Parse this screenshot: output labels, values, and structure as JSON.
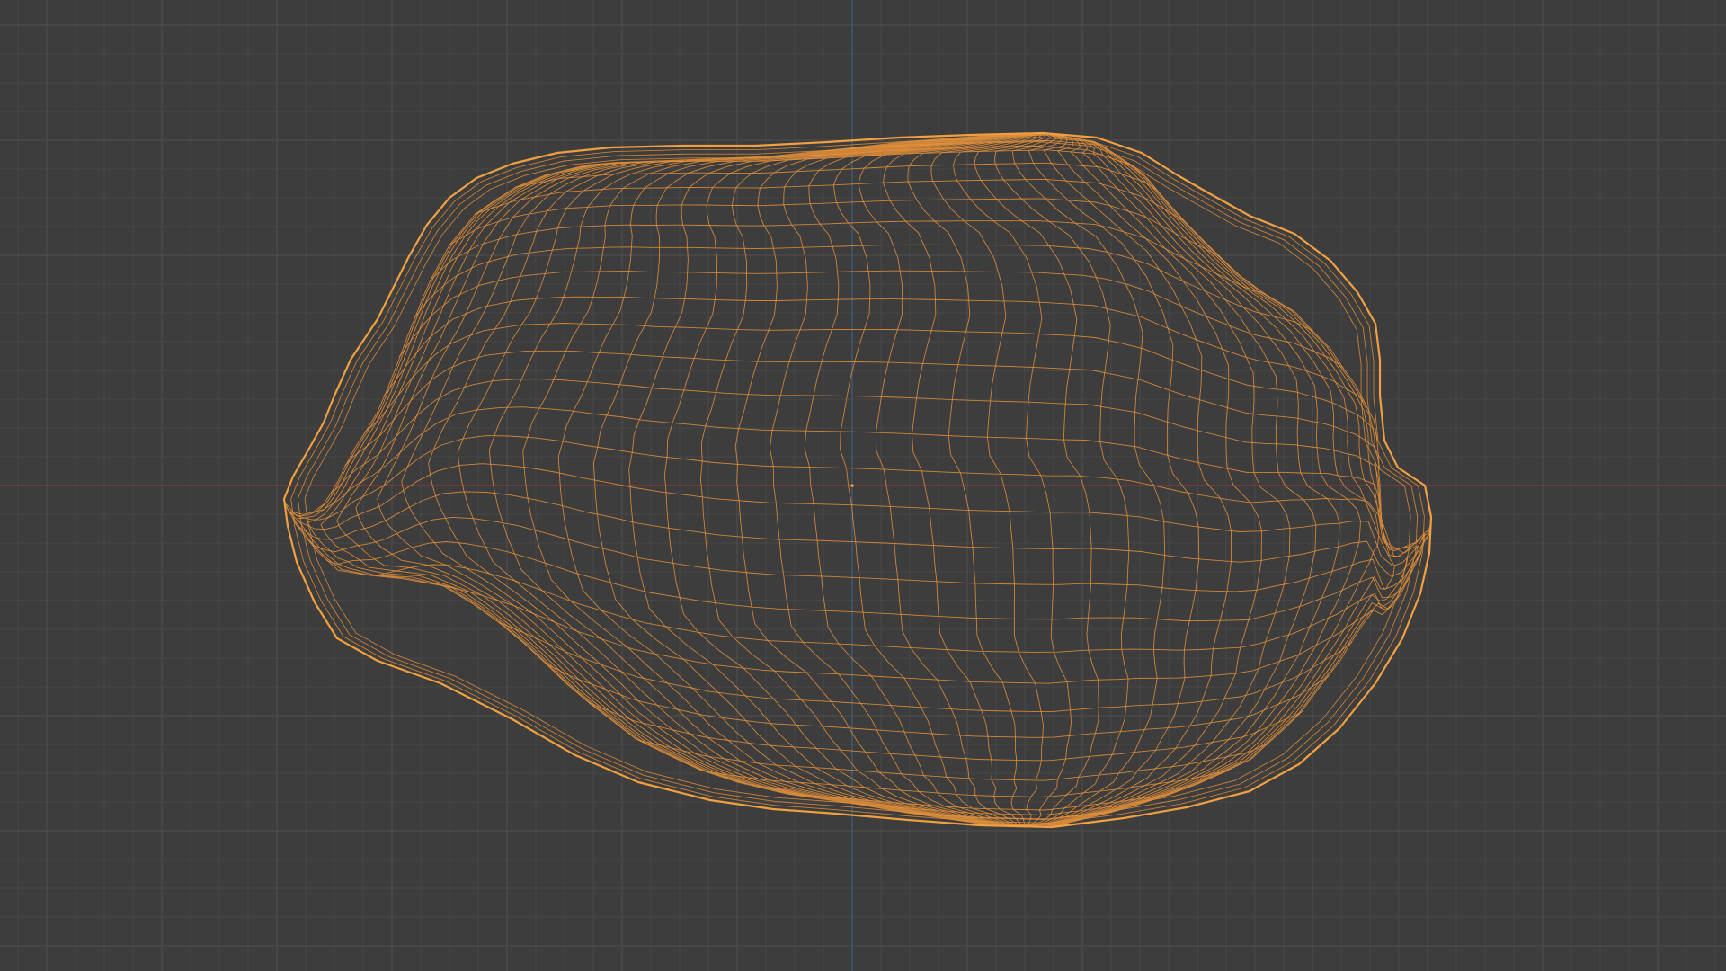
{
  "viewport": {
    "colors": {
      "background": "#3d3d3d",
      "grid_minor": "#474747",
      "grid_major": "#4f4f4f",
      "x_axis": "#8a3a40",
      "y_axis": "#3f5f80",
      "mesh_wire": "#e8923a",
      "mesh_silhouette": "#f0a040",
      "origin_point": "#f0a040"
    },
    "shading_mode": "wireframe",
    "object_selected": true
  }
}
